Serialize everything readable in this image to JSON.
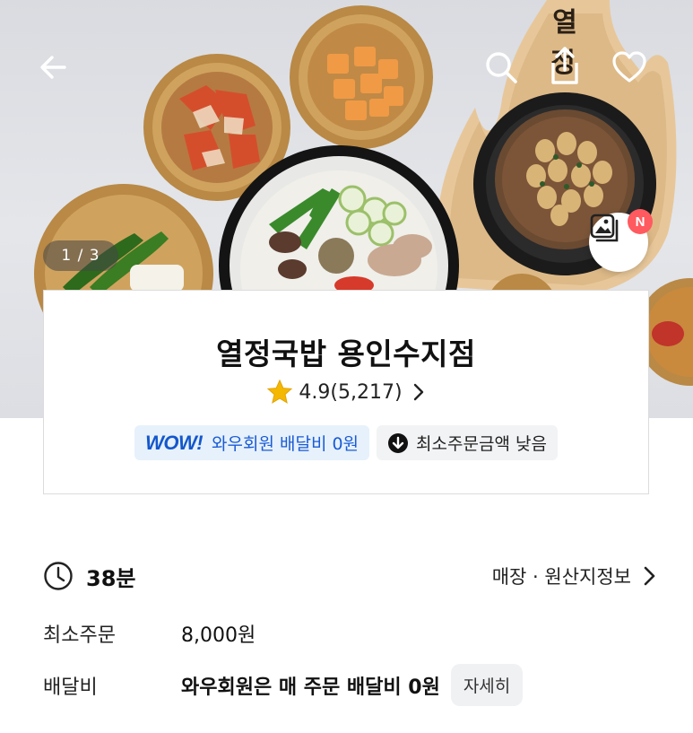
{
  "hero": {
    "counter": "1 / 3",
    "gallery_badge": "N",
    "board_text": "열정"
  },
  "store": {
    "name": "열정국밥 용인수지점",
    "rating": "4.9",
    "review_count": "(5,217)",
    "chips": {
      "wow_logo": "WOW!",
      "wow_text": "와우회원 배달비 0원",
      "min_order_text": "최소주문금액 낮음"
    }
  },
  "delivery": {
    "time": "38분",
    "store_info_link": "매장 · 원산지정보"
  },
  "details": {
    "min_order_label": "최소주문",
    "min_order_value": "8,000원",
    "fee_label": "배달비",
    "fee_value": "와우회원은 매 주문 배달비 0원",
    "fee_detail_button": "자세히"
  },
  "colors": {
    "accent_blue": "#1a5bd6",
    "chip_blue_bg": "#e6f1fb",
    "badge_red": "#ff5a5f",
    "star_yellow": "#f5b800"
  },
  "icons": [
    "back-arrow-icon",
    "search-icon",
    "share-icon",
    "heart-icon",
    "gallery-icon",
    "star-icon",
    "chevron-right-icon",
    "arrow-down-circle-icon",
    "clock-icon"
  ]
}
